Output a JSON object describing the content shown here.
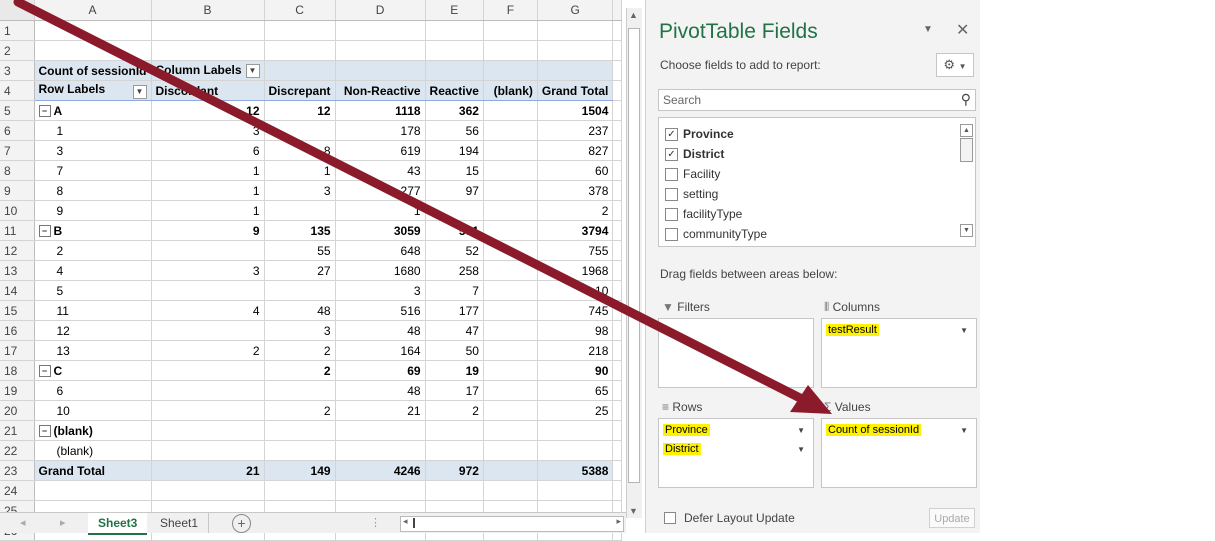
{
  "columns": [
    "A",
    "B",
    "C",
    "D",
    "E",
    "F",
    "G"
  ],
  "pivot": {
    "corner_label": "Count of sessionId",
    "column_labels": "Column Labels",
    "row_labels": "Row Labels",
    "col_headers": [
      "Discordant",
      "Discrepant",
      "Non-Reactive",
      "Reactive",
      "(blank)",
      "Grand Total"
    ],
    "rows": [
      {
        "type": "group",
        "label": "A",
        "vals": [
          "12",
          "12",
          "1118",
          "362",
          "",
          "1504"
        ]
      },
      {
        "type": "item",
        "label": "1",
        "vals": [
          "3",
          "",
          "178",
          "56",
          "",
          "237"
        ]
      },
      {
        "type": "item",
        "label": "3",
        "vals": [
          "6",
          "8",
          "619",
          "194",
          "",
          "827"
        ]
      },
      {
        "type": "item",
        "label": "7",
        "vals": [
          "1",
          "1",
          "43",
          "15",
          "",
          "60"
        ]
      },
      {
        "type": "item",
        "label": "8",
        "vals": [
          "1",
          "3",
          "277",
          "97",
          "",
          "378"
        ]
      },
      {
        "type": "item",
        "label": "9",
        "vals": [
          "1",
          "",
          "1",
          "",
          "",
          "2"
        ]
      },
      {
        "type": "group",
        "label": "B",
        "vals": [
          "9",
          "135",
          "3059",
          "591",
          "",
          "3794"
        ]
      },
      {
        "type": "item",
        "label": "2",
        "vals": [
          "",
          "55",
          "648",
          "52",
          "",
          "755"
        ]
      },
      {
        "type": "item",
        "label": "4",
        "vals": [
          "3",
          "27",
          "1680",
          "258",
          "",
          "1968"
        ]
      },
      {
        "type": "item",
        "label": "5",
        "vals": [
          "",
          "",
          "3",
          "7",
          "",
          "10"
        ]
      },
      {
        "type": "item",
        "label": "11",
        "vals": [
          "4",
          "48",
          "516",
          "177",
          "",
          "745"
        ]
      },
      {
        "type": "item",
        "label": "12",
        "vals": [
          "",
          "3",
          "48",
          "47",
          "",
          "98"
        ]
      },
      {
        "type": "item",
        "label": "13",
        "vals": [
          "2",
          "2",
          "164",
          "50",
          "",
          "218"
        ]
      },
      {
        "type": "group",
        "label": "C",
        "vals": [
          "",
          "2",
          "69",
          "19",
          "",
          "90"
        ]
      },
      {
        "type": "item",
        "label": "6",
        "vals": [
          "",
          "",
          "48",
          "17",
          "",
          "65"
        ]
      },
      {
        "type": "item",
        "label": "10",
        "vals": [
          "",
          "2",
          "21",
          "2",
          "",
          "25"
        ]
      },
      {
        "type": "group",
        "label": "(blank)",
        "vals": [
          "",
          "",
          "",
          "",
          "",
          ""
        ]
      },
      {
        "type": "item",
        "label": "(blank)",
        "vals": [
          "",
          "",
          "",
          "",
          "",
          ""
        ]
      },
      {
        "type": "total",
        "label": "Grand Total",
        "vals": [
          "21",
          "149",
          "4246",
          "972",
          "",
          "5388"
        ]
      }
    ]
  },
  "row_numbers": [
    "1",
    "2",
    "3",
    "4",
    "5",
    "6",
    "7",
    "8",
    "9",
    "10",
    "11",
    "12",
    "13",
    "14",
    "15",
    "16",
    "17",
    "18",
    "19",
    "20",
    "21",
    "22",
    "23",
    "24",
    "25",
    "26"
  ],
  "tabs": {
    "active": "Sheet3",
    "other": "Sheet1",
    "add": "+"
  },
  "panel": {
    "title": "PivotTable Fields",
    "choose_label": "Choose fields to add to report:",
    "search_placeholder": "Search",
    "fields": [
      {
        "name": "Province",
        "checked": true
      },
      {
        "name": "District",
        "checked": true
      },
      {
        "name": "Facility",
        "checked": false
      },
      {
        "name": "setting",
        "checked": false
      },
      {
        "name": "facilityType",
        "checked": false
      },
      {
        "name": "communityType",
        "checked": false
      }
    ],
    "drag_label": "Drag fields between areas below:",
    "filters_label": "Filters",
    "columns_label": "Columns",
    "rows_label": "Rows",
    "values_label": "Values",
    "columns_field": "testResult",
    "rows_fields": [
      "Province",
      "District"
    ],
    "values_field": "Count of sessionId",
    "defer_label": "Defer Layout Update",
    "update_label": "Update"
  },
  "colors": {
    "excel_green": "#217346",
    "highlight": "#fff200",
    "arrow": "#8b1a2b",
    "pivot_header": "#dce6f1"
  }
}
